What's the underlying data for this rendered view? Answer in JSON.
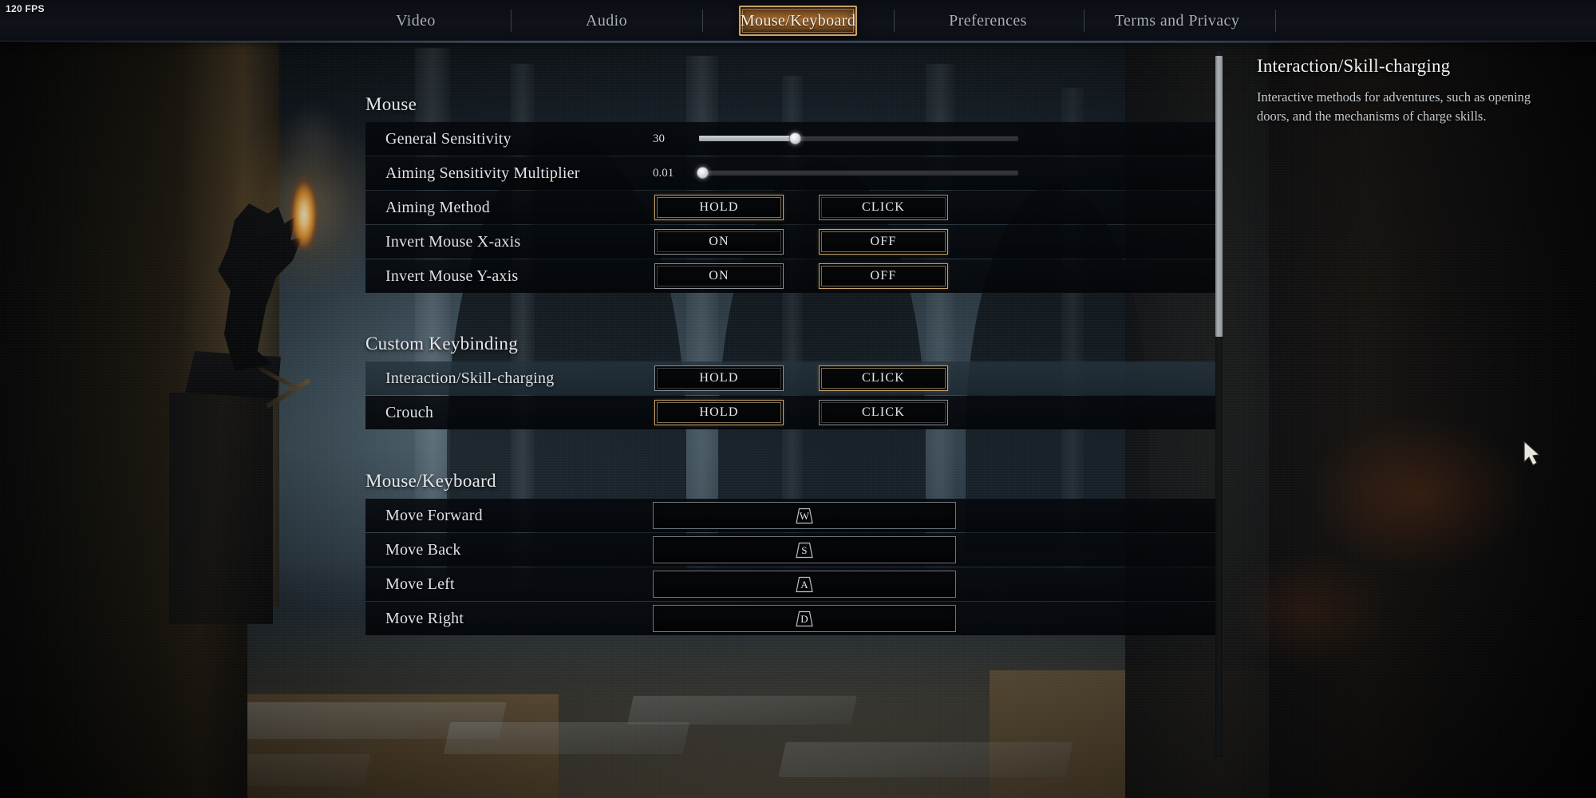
{
  "hud": {
    "fps": "120 FPS"
  },
  "nav": {
    "items": [
      {
        "label": "Video",
        "active": false
      },
      {
        "label": "Audio",
        "active": false
      },
      {
        "label": "Mouse/Keyboard",
        "active": true
      },
      {
        "label": "Preferences",
        "active": false
      },
      {
        "label": "Terms and Privacy",
        "active": false
      }
    ]
  },
  "sections": [
    {
      "title": "Mouse",
      "rows": [
        {
          "label": "General Sensitivity",
          "type": "slider",
          "value": "30",
          "percent": 30
        },
        {
          "label": "Aiming Sensitivity Multiplier",
          "type": "slider",
          "value": "0.01",
          "percent": 1
        },
        {
          "label": "Aiming Method",
          "type": "toggle",
          "options": [
            "HOLD",
            "CLICK"
          ],
          "selected": "HOLD"
        },
        {
          "label": "Invert Mouse X-axis",
          "type": "toggle",
          "options": [
            "ON",
            "OFF"
          ],
          "selected": "OFF"
        },
        {
          "label": "Invert Mouse Y-axis",
          "type": "toggle",
          "options": [
            "ON",
            "OFF"
          ],
          "selected": "OFF"
        }
      ]
    },
    {
      "title": "Custom Keybinding",
      "rows": [
        {
          "label": "Interaction/Skill-charging",
          "type": "toggle",
          "options": [
            "HOLD",
            "CLICK"
          ],
          "selected": "CLICK",
          "hover": true
        },
        {
          "label": "Crouch",
          "type": "toggle",
          "options": [
            "HOLD",
            "CLICK"
          ],
          "selected": "HOLD",
          "hover": false
        }
      ]
    },
    {
      "title": "Mouse/Keyboard",
      "rows": [
        {
          "label": "Move Forward",
          "type": "keybind",
          "key": "W"
        },
        {
          "label": "Move Back",
          "type": "keybind",
          "key": "S"
        },
        {
          "label": "Move Left",
          "type": "keybind",
          "key": "A"
        },
        {
          "label": "Move Right",
          "type": "keybind",
          "key": "D"
        }
      ]
    }
  ],
  "info": {
    "title": "Interaction/Skill-charging",
    "description": "Interactive methods for adventures, such as opening doors, and the mechanisms of charge skills."
  },
  "colors": {
    "accent_selected_border": "#c8a46b",
    "accent_tab_bg": "#a4692c",
    "text_primary": "#e4e6ea",
    "text_secondary": "#c5c9cd",
    "row_bg": "#06090d",
    "row_hover_bg": "#26343e"
  }
}
